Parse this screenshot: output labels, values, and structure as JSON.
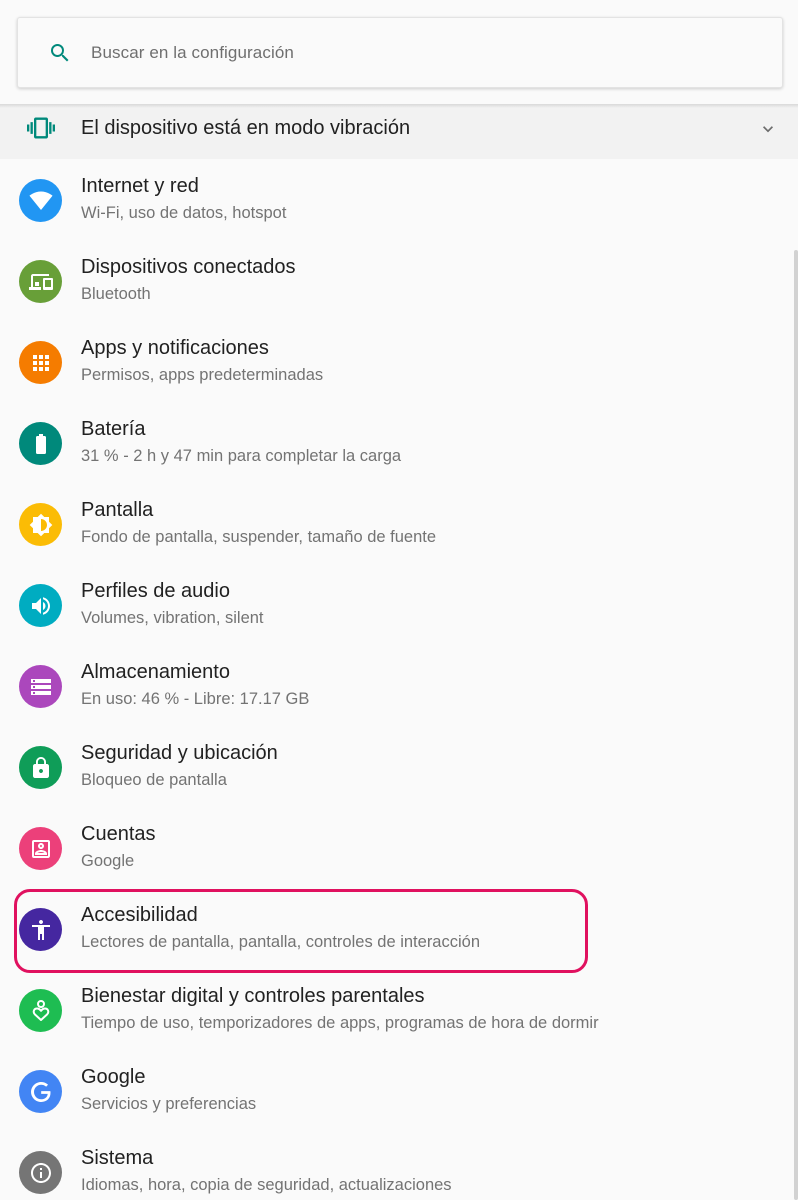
{
  "search": {
    "placeholder": "Buscar en la configuración",
    "icon": "search-icon"
  },
  "suggestion": {
    "text": "El dispositivo está en modo vibración",
    "icon": "vibrate-icon",
    "expand_icon": "chevron-down-icon"
  },
  "settings": [
    {
      "title": "Internet y red",
      "subtitle": "Wi-Fi, uso de datos, hotspot",
      "icon": "wifi-icon",
      "color": "#2196f3"
    },
    {
      "title": "Dispositivos conectados",
      "subtitle": "Bluetooth",
      "icon": "devices-icon",
      "color": "#689f38"
    },
    {
      "title": "Apps y notificaciones",
      "subtitle": "Permisos, apps predeterminadas",
      "icon": "apps-grid-icon",
      "color": "#f57c00"
    },
    {
      "title": "Batería",
      "subtitle": "31 % - 2 h y 47 min para completar la carga",
      "icon": "battery-icon",
      "color": "#00897b"
    },
    {
      "title": "Pantalla",
      "subtitle": "Fondo de pantalla, suspender, tamaño de fuente",
      "icon": "brightness-icon",
      "color": "#fbbc05"
    },
    {
      "title": "Perfiles de audio",
      "subtitle": "Volumes, vibration, silent",
      "icon": "volume-icon",
      "color": "#00acc1"
    },
    {
      "title": "Almacenamiento",
      "subtitle": "En uso: 46 % - Libre: 17.17 GB",
      "icon": "storage-icon",
      "color": "#ab47bc"
    },
    {
      "title": "Seguridad y ubicación",
      "subtitle": "Bloqueo de pantalla",
      "icon": "lock-icon",
      "color": "#0f9d58"
    },
    {
      "title": "Cuentas",
      "subtitle": "Google",
      "icon": "account-icon",
      "color": "#ec407a"
    },
    {
      "title": "Accesibilidad",
      "subtitle": "Lectores de pantalla, pantalla, controles de interacción",
      "icon": "accessibility-icon",
      "color": "#4527a0"
    },
    {
      "title": "Bienestar digital y controles parentales",
      "subtitle": "Tiempo de uso, temporizadores de apps, programas de hora de dormir",
      "icon": "wellbeing-heart-icon",
      "color": "#1ebd52"
    },
    {
      "title": "Google",
      "subtitle": "Servicios y preferencias",
      "icon": "google-g-icon",
      "color": "#4285f4"
    },
    {
      "title": "Sistema",
      "subtitle": "Idiomas, hora, copia de seguridad, actualizaciones",
      "icon": "info-icon",
      "color": "#757575"
    }
  ],
  "colors": {
    "accent": "#00897b",
    "highlight": "#e0115f"
  }
}
